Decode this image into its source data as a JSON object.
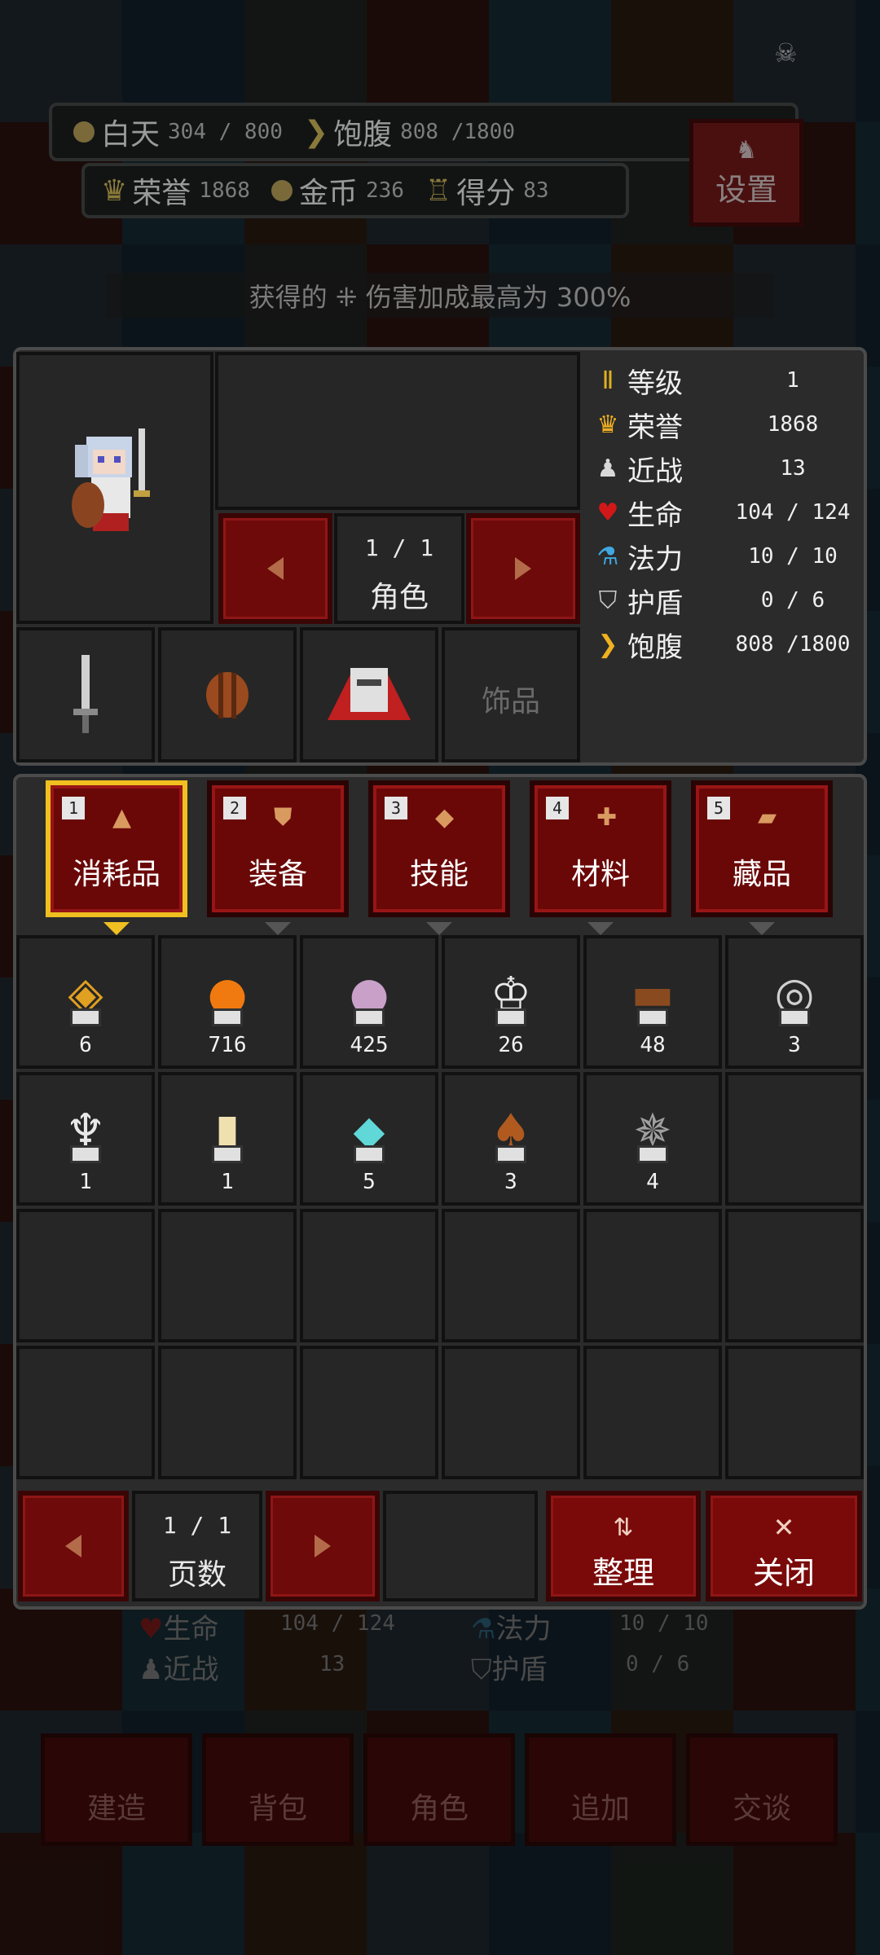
{
  "hud": {
    "daytime_label": "白天",
    "daytime_value": "304 / 800",
    "satiety_label": "饱腹",
    "satiety_value": "808 /1800",
    "honor_label": "荣誉",
    "honor_value": "1868",
    "gold_label": "金币",
    "gold_value": "236",
    "score_label": "得分",
    "score_value": "83",
    "settings_label": "设置"
  },
  "notice": "获得的 ⁜ 伤害加成最高为 300%",
  "character": {
    "pager": "1 / 1",
    "pager_label": "角色",
    "accessory_label": "饰品"
  },
  "stats": [
    {
      "icon": "level-icon",
      "glyph": "Ⅱ",
      "color": "#e0b020",
      "label": "等级",
      "value": "1"
    },
    {
      "icon": "crown-icon",
      "glyph": "♛",
      "color": "#f0b020",
      "label": "荣誉",
      "value": "1868"
    },
    {
      "icon": "melee-icon",
      "glyph": "♟",
      "color": "#d8d8d8",
      "label": "近战",
      "value": "13"
    },
    {
      "icon": "heart-icon",
      "glyph": "♥",
      "color": "#d01818",
      "label": "生命",
      "value": "104 / 124"
    },
    {
      "icon": "mana-icon",
      "glyph": "⚗",
      "color": "#40a8e0",
      "label": "法力",
      "value": "10 / 10"
    },
    {
      "icon": "shield-icon",
      "glyph": "⛉",
      "color": "#cfcfcf",
      "label": "护盾",
      "value": "0 / 6"
    },
    {
      "icon": "satiety-icon",
      "glyph": "❯",
      "color": "#f0b020",
      "label": "饱腹",
      "value": "808 /1800"
    }
  ],
  "tabs": [
    {
      "num": "1",
      "label": "消耗品",
      "icon": "flask-icon",
      "glyph": "▲",
      "color": "#d99a60",
      "active": true
    },
    {
      "num": "2",
      "label": "装备",
      "icon": "armor-icon",
      "glyph": "⛊",
      "color": "#d99a60",
      "active": false
    },
    {
      "num": "3",
      "label": "技能",
      "icon": "skill-icon",
      "glyph": "◆",
      "color": "#d99a60",
      "active": false
    },
    {
      "num": "4",
      "label": "材料",
      "icon": "material-icon",
      "glyph": "✚",
      "color": "#d99a60",
      "active": false
    },
    {
      "num": "5",
      "label": "藏品",
      "icon": "collectible-icon",
      "glyph": "▰",
      "color": "#d99a60",
      "active": false
    }
  ],
  "inventory": [
    {
      "icon": "gold-amulet-icon",
      "glyph": "◈",
      "color": "#e0a020",
      "count": "6"
    },
    {
      "icon": "pumpkin-icon",
      "glyph": "●",
      "color": "#f07a10",
      "count": "716"
    },
    {
      "icon": "turnip-icon",
      "glyph": "●",
      "color": "#c8a0c8",
      "count": "425"
    },
    {
      "icon": "crown-item-icon",
      "glyph": "♔",
      "color": "#e8e8e8",
      "count": "26"
    },
    {
      "icon": "chest-icon",
      "glyph": "▬",
      "color": "#8a4a20",
      "count": "48"
    },
    {
      "icon": "target-icon",
      "glyph": "◎",
      "color": "#cfcfcf",
      "count": "3"
    },
    {
      "icon": "angel-statue-icon",
      "glyph": "♆",
      "color": "#e8e8e8",
      "count": "1"
    },
    {
      "icon": "jar-icon",
      "glyph": "▮",
      "color": "#f0e0b0",
      "count": "1"
    },
    {
      "icon": "crystal-icon",
      "glyph": "⬥",
      "color": "#60d8d8",
      "count": "5"
    },
    {
      "icon": "totem-icon",
      "glyph": "♠",
      "color": "#b05a20",
      "count": "3"
    },
    {
      "icon": "spider-icon",
      "glyph": "✵",
      "color": "#a0a0a0",
      "count": "4"
    }
  ],
  "bottom_bar": {
    "pager": "1 / 1",
    "pager_label": "页数",
    "sort_label": "整理",
    "close_label": "关闭"
  },
  "background_ui": {
    "life_label": "生命",
    "life_value": "104 / 124",
    "mana_label": "法力",
    "mana_value": "10 / 10",
    "melee_label": "近战",
    "melee_value": "13",
    "shield_label": "护盾",
    "shield_value": "0 / 6",
    "nav": [
      "建造",
      "背包",
      "角色",
      "追加",
      "交谈"
    ]
  }
}
